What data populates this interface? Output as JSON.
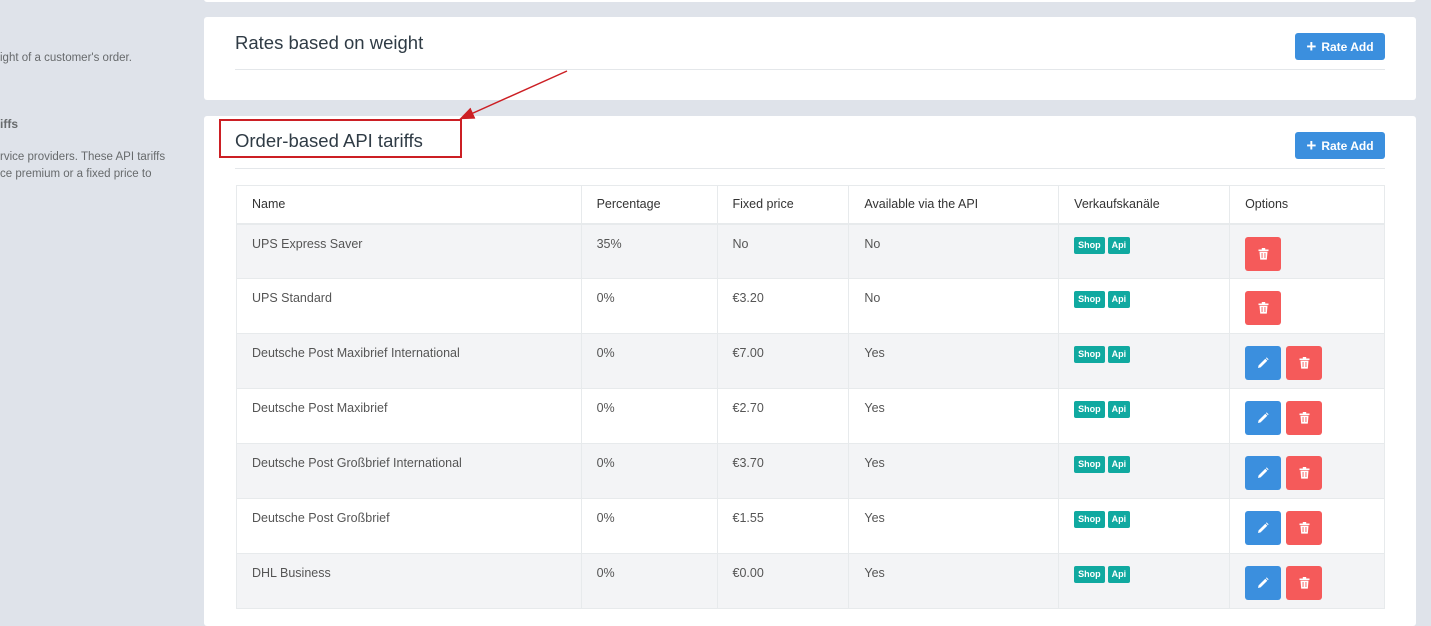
{
  "sidebar": {
    "line1": "ight of a customer's order.",
    "heading": "iffs",
    "line2": "rvice providers. These API tariffs",
    "line3": "ce premium or a fixed price to"
  },
  "weight_card": {
    "title": "Rates based on weight",
    "add_label": "Rate Add"
  },
  "api_card": {
    "title": "Order-based API tariffs",
    "add_label": "Rate Add"
  },
  "table": {
    "headers": [
      "Name",
      "Percentage",
      "Fixed price",
      "Available via the API",
      "Verkaufskanäle",
      "Options"
    ],
    "rows": [
      {
        "name": "UPS Express Saver",
        "percentage": "35%",
        "fixed": "No",
        "api": "No",
        "channels": [
          "Shop",
          "Api"
        ],
        "editable": false
      },
      {
        "name": "UPS Standard",
        "percentage": "0%",
        "fixed": "€3.20",
        "api": "No",
        "channels": [
          "Shop",
          "Api"
        ],
        "editable": false
      },
      {
        "name": "Deutsche Post Maxibrief International",
        "percentage": "0%",
        "fixed": "€7.00",
        "api": "Yes",
        "channels": [
          "Shop",
          "Api"
        ],
        "editable": true
      },
      {
        "name": "Deutsche Post Maxibrief",
        "percentage": "0%",
        "fixed": "€2.70",
        "api": "Yes",
        "channels": [
          "Shop",
          "Api"
        ],
        "editable": true
      },
      {
        "name": "Deutsche Post Großbrief International",
        "percentage": "0%",
        "fixed": "€3.70",
        "api": "Yes",
        "channels": [
          "Shop",
          "Api"
        ],
        "editable": true
      },
      {
        "name": "Deutsche Post Großbrief",
        "percentage": "0%",
        "fixed": "€1.55",
        "api": "Yes",
        "channels": [
          "Shop",
          "Api"
        ],
        "editable": true
      },
      {
        "name": "DHL Business",
        "percentage": "0%",
        "fixed": "€0.00",
        "api": "Yes",
        "channels": [
          "Shop",
          "Api"
        ],
        "editable": true
      }
    ]
  },
  "colors": {
    "primary": "#3b8fde",
    "danger": "#f55a5a",
    "badge": "#10a9a0",
    "annotation": "#cc1f24"
  },
  "icons": {
    "add": "plus-icon",
    "edit": "pencil-icon",
    "delete": "trash-icon"
  }
}
